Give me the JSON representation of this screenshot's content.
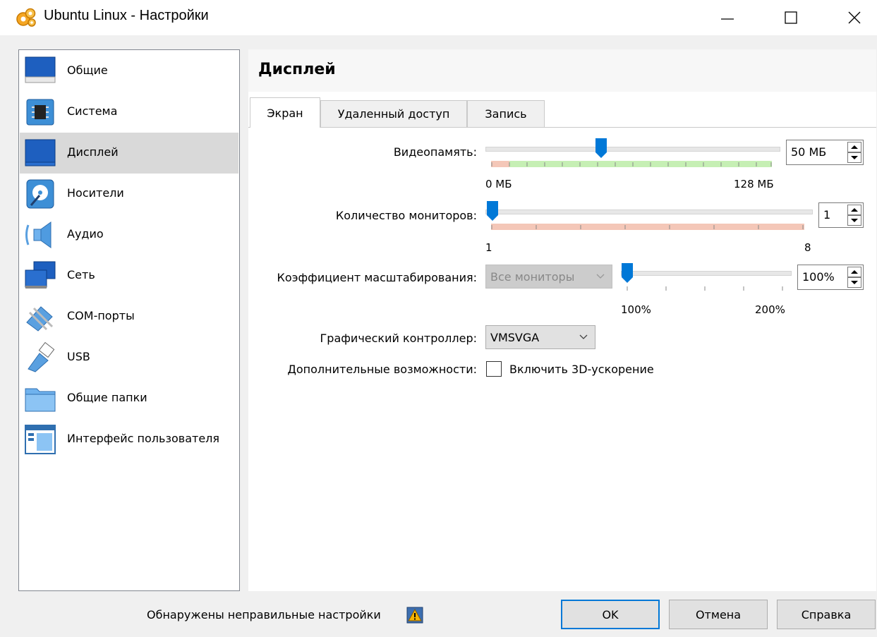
{
  "window": {
    "title": "Ubuntu Linux - Настройки",
    "app_icon": "gear-cluster-icon",
    "controls": [
      "minimize-icon",
      "maximize-icon",
      "close-icon"
    ]
  },
  "sidebar": {
    "items": [
      {
        "label": "Общие",
        "icon": "monitor-general-icon"
      },
      {
        "label": "Система",
        "icon": "chip-icon"
      },
      {
        "label": "Дисплей",
        "icon": "display-icon",
        "selected": true
      },
      {
        "label": "Носители",
        "icon": "disk-icon"
      },
      {
        "label": "Аудио",
        "icon": "speaker-icon"
      },
      {
        "label": "Сеть",
        "icon": "network-icon"
      },
      {
        "label": "COM-порты",
        "icon": "serial-port-icon"
      },
      {
        "label": "USB",
        "icon": "usb-icon"
      },
      {
        "label": "Общие папки",
        "icon": "folder-icon"
      },
      {
        "label": "Интерфейс пользователя",
        "icon": "user-interface-icon"
      }
    ]
  },
  "main": {
    "title": "Дисплей",
    "tabs": [
      {
        "label": "Экран",
        "active": true
      },
      {
        "label": "Удаленный доступ",
        "active": false
      },
      {
        "label": "Запись",
        "active": false
      }
    ],
    "video_memory": {
      "label": "Видеопамять:",
      "min_label": "0 МБ",
      "max_label": "128 МБ",
      "value": 50,
      "max": 128,
      "display": "50 МБ"
    },
    "monitors": {
      "label": "Количество мониторов:",
      "min_label": "1",
      "max_label": "8",
      "value": 1,
      "min": 1,
      "max": 8,
      "display": "1"
    },
    "scale": {
      "label": "Коэффициент масштабирования:",
      "combo": "Все мониторы",
      "min_label": "100%",
      "max_label": "200%",
      "value": 100,
      "display": "100%"
    },
    "controller": {
      "label": "Графический контроллер:",
      "value": "VMSVGA"
    },
    "extended": {
      "label": "Дополнительные возможности:",
      "checkbox_label": "Включить 3D-ускорение",
      "checked": false
    }
  },
  "footer": {
    "warning": "Обнаружены неправильные настройки",
    "warning_icon": "warning-icon",
    "ok": "OK",
    "cancel": "Отмена",
    "help": "Справка"
  },
  "colors": {
    "accent": "#0078d7",
    "selection": "#d9d9d9",
    "band_green": "#c6efb4",
    "band_red": "#f4c7b8"
  }
}
